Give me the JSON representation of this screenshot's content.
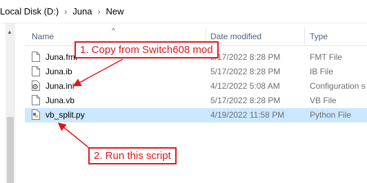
{
  "breadcrumb": {
    "items": [
      "Local Disk (D:)",
      "Juna",
      "New"
    ],
    "separator": "›"
  },
  "columns": {
    "name": "Name",
    "date_modified": "Date modified",
    "type": "Type"
  },
  "files": [
    {
      "name": "Juna.fmt",
      "date": "5/17/2022 8:28 PM",
      "type": "FMT File",
      "icon": "document-icon"
    },
    {
      "name": "Juna.ib",
      "date": "5/17/2022 8:28 PM",
      "type": "IB File",
      "icon": "document-icon"
    },
    {
      "name": "Juna.ini",
      "date": "4/12/2022 5:08 AM",
      "type": "Configuration s",
      "icon": "settings-file-icon"
    },
    {
      "name": "Juna.vb",
      "date": "5/17/2022 8:28 PM",
      "type": "VB File",
      "icon": "document-icon"
    },
    {
      "name": "vb_split.py",
      "date": "4/19/2022 11:58 PM",
      "type": "Python File",
      "icon": "python-icon",
      "selected": true
    }
  ],
  "annotations": {
    "callout_1": "1. Copy from Switch608 mod",
    "callout_2": "2. Run this script",
    "color": "#e3141b"
  },
  "colors": {
    "selection": "#cce8ff",
    "header_text": "#4c607a"
  }
}
